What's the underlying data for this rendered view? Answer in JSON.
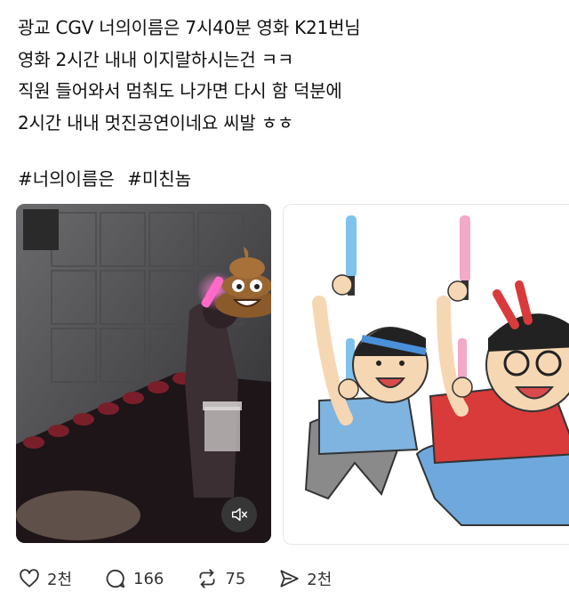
{
  "post": {
    "lines": [
      "광교 CGV 너의이름은 7시40분 영화 K21번님",
      "영화 2시간 내내 이지랄하시는건 ㅋㅋ",
      "직원 들어와서 멈춰도 나가면 다시 함 덕분에",
      "2시간 내내 멋진공연이네요  씨발 ㅎㅎ"
    ],
    "hashtags": [
      "#너의이름은",
      "#미친놈"
    ]
  },
  "media": {
    "left": {
      "kind": "video",
      "description_icon": "poop-emoji"
    },
    "right": {
      "kind": "image"
    }
  },
  "actions": {
    "like_count": "2천",
    "reply_count": "166",
    "repost_count": "75",
    "share_count": "2천"
  },
  "colors": {
    "glowstick_pink": "#e05aa0",
    "glowstick_blue": "#7fc3ec",
    "text": "#111111"
  }
}
